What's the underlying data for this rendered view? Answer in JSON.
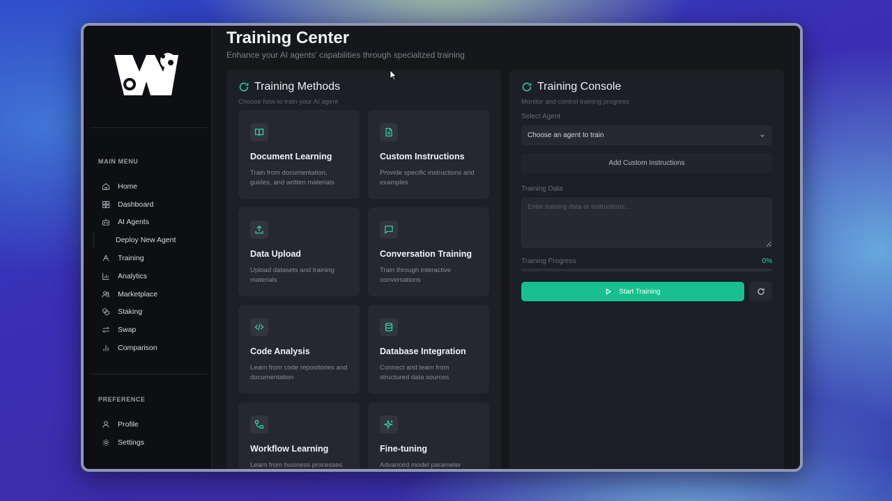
{
  "app": {
    "title": "Training Center",
    "subtitle": "Enhance your AI agents' capabilities through specialized training"
  },
  "sidebar": {
    "main_menu_label": "MAIN MENU",
    "items": [
      {
        "label": "Home",
        "icon": "home-icon"
      },
      {
        "label": "Dashboard",
        "icon": "dashboard-icon"
      },
      {
        "label": "AI Agents",
        "icon": "bot-icon"
      },
      {
        "label": "Deploy New Agent",
        "icon": ""
      },
      {
        "label": "Training",
        "icon": "training-icon"
      },
      {
        "label": "Analytics",
        "icon": "analytics-icon"
      },
      {
        "label": "Marketplace",
        "icon": "users-icon"
      },
      {
        "label": "Staking",
        "icon": "coins-icon"
      },
      {
        "label": "Swap",
        "icon": "swap-icon"
      },
      {
        "label": "Comparison",
        "icon": "bar-chart-icon"
      }
    ],
    "preference_label": "PREFERENCE",
    "preference_items": [
      {
        "label": "Profile",
        "icon": "user-icon"
      },
      {
        "label": "Settings",
        "icon": "gear-icon"
      }
    ]
  },
  "methods": {
    "title": "Training Methods",
    "subtitle": "Choose how to train your AI agent",
    "cards": [
      {
        "title": "Document Learning",
        "desc": "Train from documentation, guides, and written materials",
        "icon": "book-icon"
      },
      {
        "title": "Custom Instructions",
        "desc": "Provide specific instructions and examples",
        "icon": "file-text-icon"
      },
      {
        "title": "Data Upload",
        "desc": "Upload datasets and training materials",
        "icon": "upload-icon"
      },
      {
        "title": "Conversation Training",
        "desc": "Train through interactive conversations",
        "icon": "chat-icon"
      },
      {
        "title": "Code Analysis",
        "desc": "Learn from code repositories and documentation",
        "icon": "code-icon"
      },
      {
        "title": "Database Integration",
        "desc": "Connect and learn from structured data sources",
        "icon": "database-icon"
      },
      {
        "title": "Workflow Learning",
        "desc": "Learn from business processes",
        "icon": "workflow-icon"
      },
      {
        "title": "Fine-tuning",
        "desc": "Advanced model parameter",
        "icon": "sparkles-icon"
      }
    ]
  },
  "console": {
    "title": "Training Console",
    "subtitle": "Monitor and control training progress",
    "select_agent_label": "Select Agent",
    "select_agent_value": "Choose an agent to train",
    "add_instructions_label": "Add Custom Instructions",
    "training_data_label": "Training Data",
    "training_data_placeholder": "Enter training data or instructions...",
    "progress_label": "Training Progress",
    "progress_text": "0%",
    "progress_value": 0,
    "start_label": "Start Training"
  },
  "colors": {
    "accent": "#2ed3a0",
    "start_button": "#17c08d"
  }
}
